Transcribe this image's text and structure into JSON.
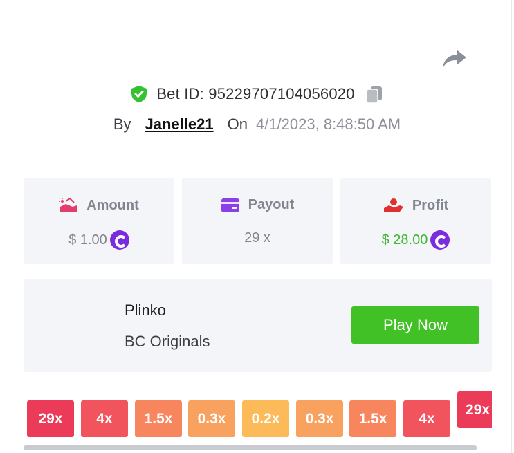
{
  "bet": {
    "id_label": "Bet ID: 95229707104056020",
    "by_label": "By",
    "username": "Janelle21",
    "on_label": "On",
    "datetime": "4/1/2023, 8:48:50 AM"
  },
  "stats": {
    "amount": {
      "label": "Amount",
      "value": "$ 1.00",
      "icon": "money-hand-icon"
    },
    "payout": {
      "label": "Payout",
      "value": "29 x",
      "icon": "credit-card-icon"
    },
    "profit": {
      "label": "Profit",
      "value": "$ 28.00",
      "icon": "profit-hand-icon"
    }
  },
  "game": {
    "name": "Plinko",
    "category": "BC Originals",
    "play_label": "Play Now"
  },
  "multipliers": [
    "29x",
    "4x",
    "1.5x",
    "0.3x",
    "0.2x",
    "0.3x",
    "1.5x",
    "4x",
    "29x"
  ],
  "colors": {
    "accent_green": "#41c125",
    "profit_green": "#3cb82c",
    "coin_purple": "#7b2be0",
    "multiplier_colors": [
      "#ec3b58",
      "#f2545d",
      "#f7865f",
      "#f9a15f",
      "#fcba58",
      "#f9a15f",
      "#f7865f",
      "#f2545d",
      "#ec3b58"
    ]
  }
}
